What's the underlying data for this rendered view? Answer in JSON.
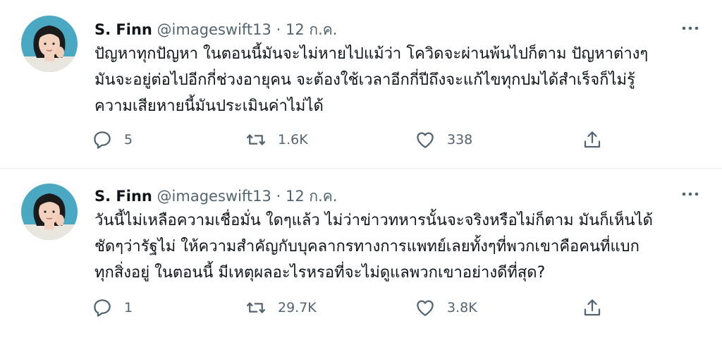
{
  "tweets": [
    {
      "name": "S. Finn",
      "handle": "@imageswift13",
      "dot": "·",
      "date": "12 ก.ค.",
      "text": "ปัญหาทุกปัญหา ในตอนนี้มันจะไม่หายไปแม้ว่า โควิดจะผ่านพ้นไปก็ตาม ปัญหาต่างๆ\nมันจะอยู่ต่อไปอีกกี่ช่วงอายุคน จะต้องใช้เวลาอีกกี่ปีถึงจะแก้ไขทุกปมได้สำเร็จก็ไม่รู้\nความเสียหายนี้มันประเมินค่าไม่ได้",
      "reply_count": "5",
      "retweet_count": "1.6K",
      "like_count": "338",
      "icons": {
        "reply": "reply-icon",
        "retweet": "retweet-icon",
        "like": "heart-icon",
        "share": "share-icon",
        "more": "more-icon"
      }
    },
    {
      "name": "S. Finn",
      "handle": "@imageswift13",
      "dot": "·",
      "date": "12 ก.ค.",
      "text": "วันนี้ไม่เหลือความเชื่อมั่น ใดๆแล้ว ไม่ว่าข่าวทหารนั้นจะจริงหรือไม่ก็ตาม มันก็เห็นได้\nชัดๆว่ารัฐไม่ ให้ความสำคัญกับบุคลากรทางการแพทย์เลยทั้งๆที่พวกเขาคือคนที่แบก\nทุกสิ่งอยู่ ในตอนนี้ มีเหตุผลอะไรหรอที่จะไม่ดูแลพวกเขาอย่างดีที่สุด?",
      "reply_count": "1",
      "retweet_count": "29.7K",
      "like_count": "3.8K",
      "icons": {
        "reply": "reply-icon",
        "retweet": "retweet-icon",
        "like": "heart-icon",
        "share": "share-icon",
        "more": "more-icon"
      }
    }
  ],
  "colors": {
    "text": "#0f1419",
    "secondary": "#536471",
    "divider": "#e6ecf0",
    "avatar_bg": "#4aa8c2"
  }
}
